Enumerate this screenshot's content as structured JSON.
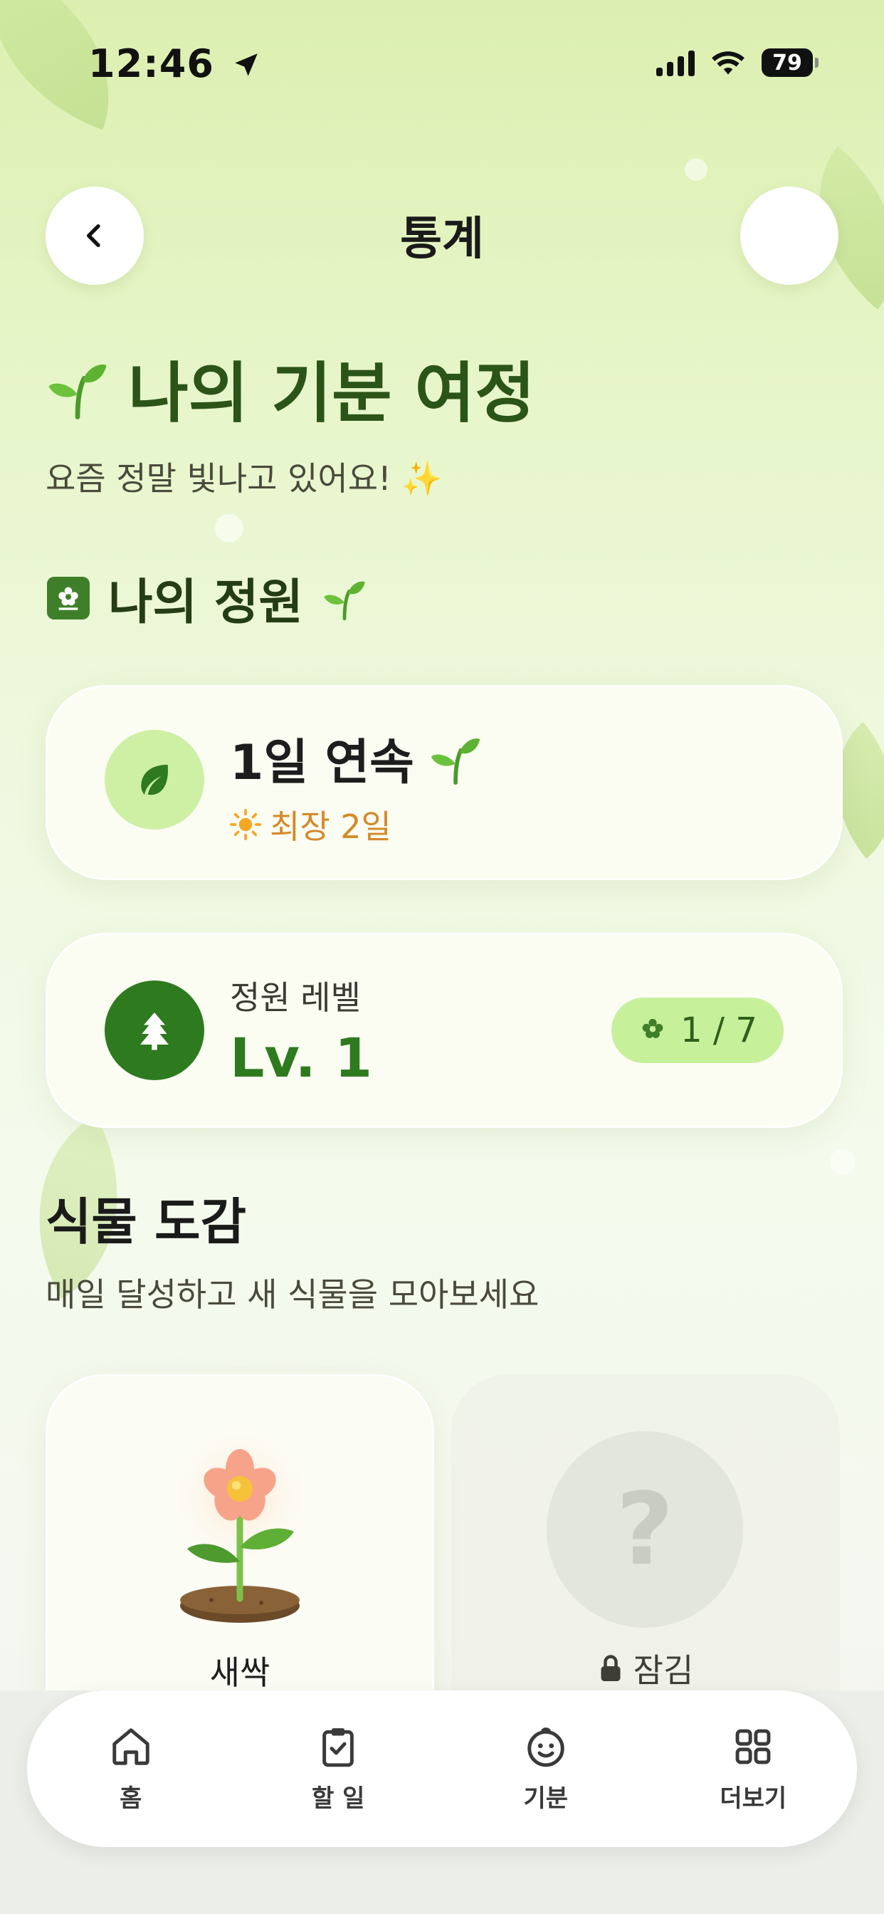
{
  "status_bar": {
    "time": "12:46",
    "battery": "79"
  },
  "header": {
    "title": "통계"
  },
  "hero": {
    "title": "나의 기분 여정",
    "subtitle": "요즘 정말 빛나고 있어요! ✨"
  },
  "garden": {
    "title": "나의 정원"
  },
  "streak": {
    "title": "1일 연속",
    "best": "최장 2일"
  },
  "level": {
    "label": "정원 레벨",
    "value": "Lv. 1",
    "progress": "1 / 7"
  },
  "collection": {
    "title": "식물 도감",
    "subtitle": "매일 달성하고 새 식물을 모아보세요",
    "items": [
      {
        "name": "새싹",
        "locked": false
      },
      {
        "name": "잠김",
        "locked": true,
        "placeholder": "?"
      }
    ]
  },
  "tabs": [
    {
      "label": "홈",
      "icon": "home-icon"
    },
    {
      "label": "할 일",
      "icon": "clipboard-check-icon"
    },
    {
      "label": "기분",
      "icon": "smile-icon"
    },
    {
      "label": "더보기",
      "icon": "grid-icon"
    }
  ],
  "colors": {
    "accent": "#2e7a1f",
    "best": "#d38a2a",
    "pill": "#c7f09a"
  }
}
